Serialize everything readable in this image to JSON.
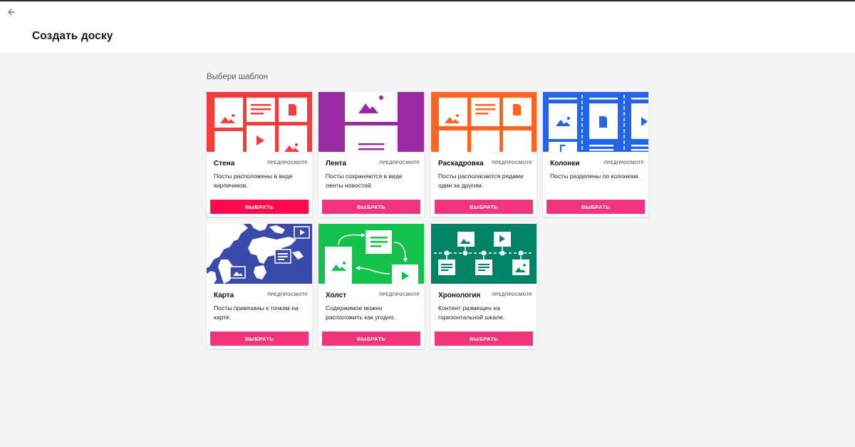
{
  "header": {
    "title": "Создать доску"
  },
  "section_label": "Выбери шаблон",
  "colors": {
    "wall": "#f43e3e",
    "stream": "#9a2aa3",
    "storyboard": "#ff6420",
    "columns": "#2265e8",
    "map": "#3a4aab",
    "canvas": "#12c24d",
    "timeline": "#008267",
    "button": "#f2357a",
    "button_active": "#ff0a4f"
  },
  "templates": [
    {
      "name": "Стена",
      "preview": "ПРЕДПРОСМОТР",
      "desc": "Посты расположены в виде кирпичиков.",
      "button": "ВЫБРАТЬ"
    },
    {
      "name": "Лента",
      "preview": "ПРЕДПРОСМОТР",
      "desc": "Посты сохраняются в виде ленты новостей.",
      "button": "ВЫБРАТЬ"
    },
    {
      "name": "Раскадровка",
      "preview": "ПРЕДПРОСМОТР",
      "desc": "Посты располагаются рядами один за другим.",
      "button": "ВЫБРАТЬ"
    },
    {
      "name": "Колонки",
      "preview": "ПРЕДПРОСМОТР",
      "desc": "Посты разделены по колонкам.",
      "button": "ВЫБРАТЬ"
    },
    {
      "name": "Карта",
      "preview": "ПРЕДПРОСМОТР",
      "desc": "Посты привязаны к точкам на карте.",
      "button": "ВЫБРАТЬ"
    },
    {
      "name": "Холст",
      "preview": "ПРЕДПРОСМОТР",
      "desc": "Содержимое можно расположить как угодно.",
      "button": "ВЫБРАТЬ"
    },
    {
      "name": "Хронология",
      "preview": "ПРЕДПРОСМОТР",
      "desc": "Контент размещен на горизонтальной шкале.",
      "button": "ВЫБРАТЬ"
    }
  ]
}
